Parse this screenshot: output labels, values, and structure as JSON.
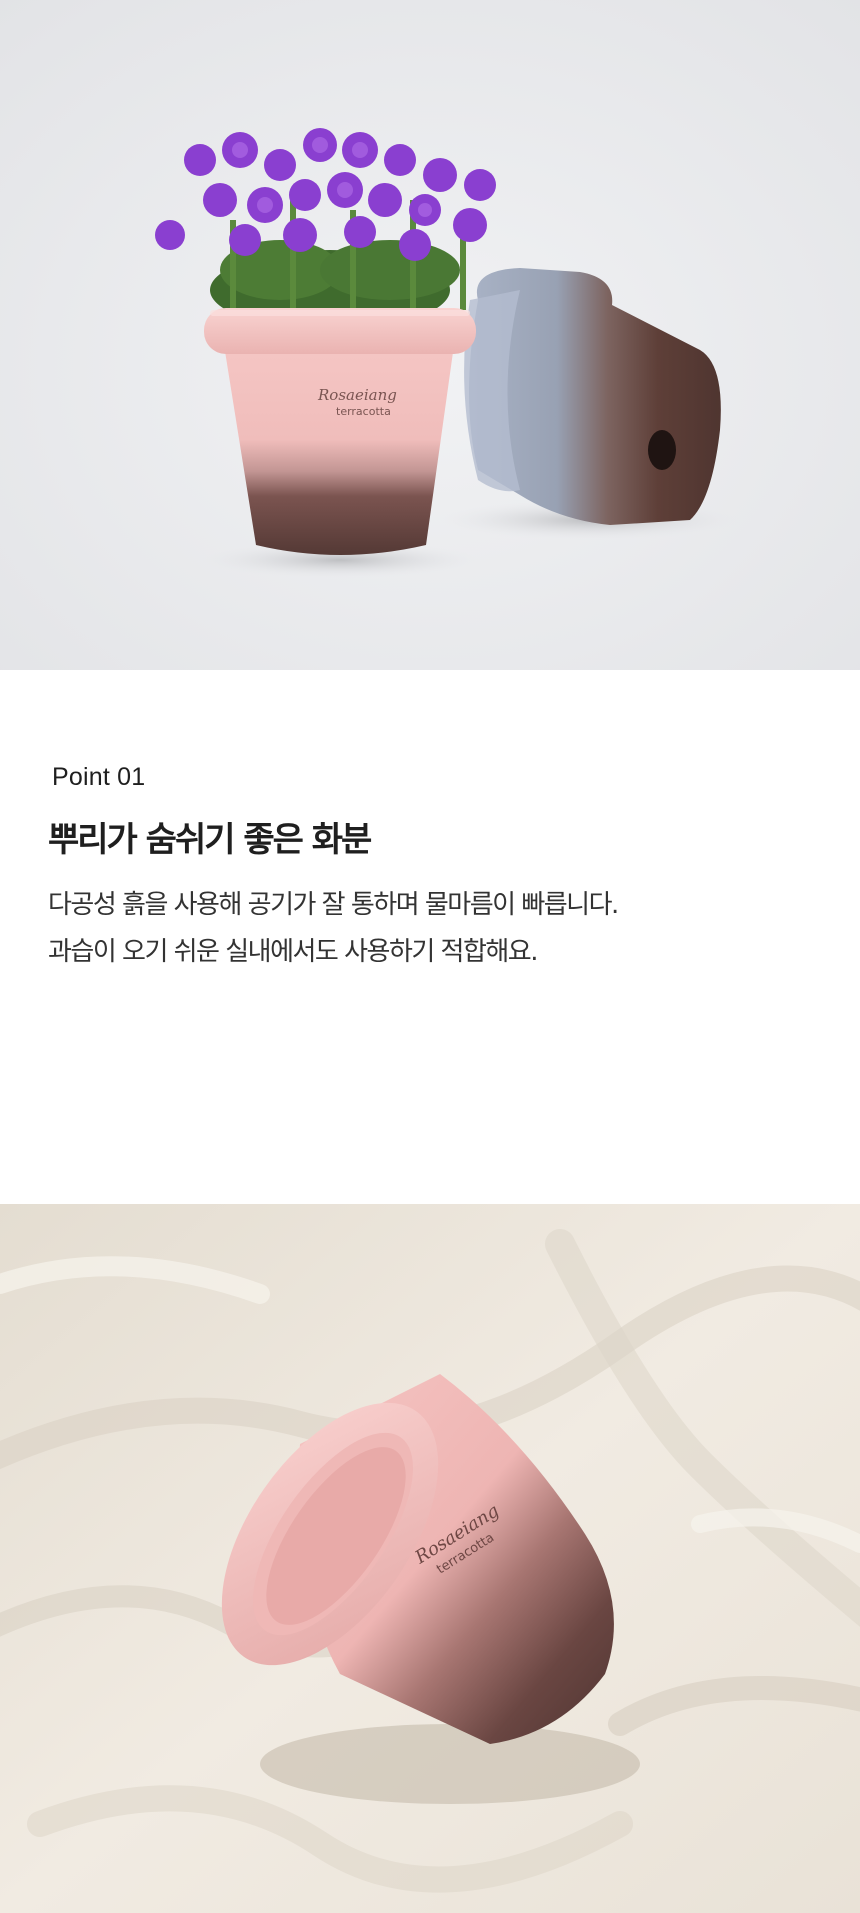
{
  "section": {
    "point_label": "Point 01",
    "headline": "뿌리가 숨쉬기 좋은 화분",
    "body_lines": [
      "다공성 흙을 사용해 공기가 잘 통하며 물마름이 빠릅니다.",
      "과습이 오기 쉬운 실내에서도 사용하기 적합해요."
    ]
  },
  "pot_engraving": {
    "brand_script": "Rosaeiang",
    "brand_sub": "terracotta"
  },
  "colors": {
    "pot_pink": "#f3c2c0",
    "pot_brown": "#5a3c38",
    "flower_purple": "#8a3fd0",
    "background_grey": "#ebecee",
    "fabric_cream": "#efe9df",
    "text_dark": "#1f1f1f"
  }
}
